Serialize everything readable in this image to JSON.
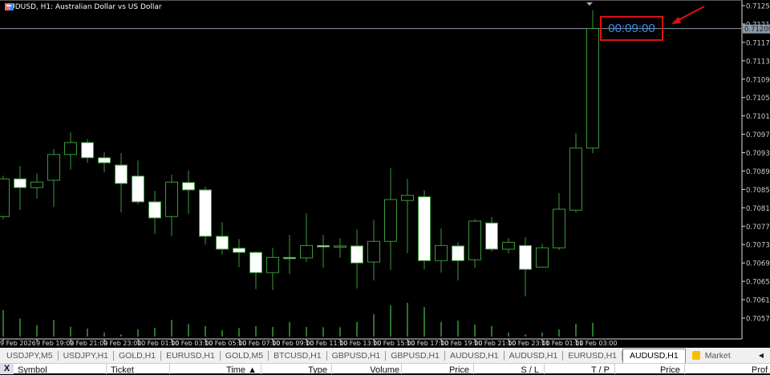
{
  "window": {
    "title": "AUDUSD, H1:  Australian Dollar vs US Dollar",
    "timer": "00:09:00"
  },
  "colors": {
    "background": "#000000",
    "bull": "#3a9a3a",
    "bear_fill": "#ffffff",
    "timer_text": "#3c8df0",
    "highlight_box": "#e01010",
    "volume": "#3a9a3a"
  },
  "chart_data": {
    "type": "candlestick",
    "symbol": "AUDUSD",
    "timeframe": "H1",
    "ylim": [
      0.7055,
      0.7127
    ],
    "price_ticks": [
      "0.71250",
      "0.71210",
      "0.71170",
      "0.71130",
      "0.71090",
      "0.71050",
      "0.71010",
      "0.70970",
      "0.70930",
      "0.70890",
      "0.70850",
      "0.70810",
      "0.70770",
      "0.70730",
      "0.70690",
      "0.70650",
      "0.70610",
      "0.70570"
    ],
    "current_price": "0.71200",
    "time_labels": [
      "9 Feb 2026",
      "9 Feb 19:00",
      "9 Feb 21:00",
      "9 Feb 23:00",
      "10 Feb 01:00",
      "10 Feb 03:00",
      "10 Feb 05:00",
      "10 Feb 07:00",
      "10 Feb 09:00",
      "10 Feb 11:00",
      "10 Feb 13:00",
      "10 Feb 15:00",
      "10 Feb 17:00",
      "10 Feb 19:00",
      "10 Feb 21:00",
      "10 Feb 23:00",
      "11 Feb 01:00",
      "11 Feb 03:00"
    ],
    "ohlc": [
      [
        0.70791,
        0.7088,
        0.70785,
        0.70873
      ],
      [
        0.70873,
        0.70901,
        0.70805,
        0.70854
      ],
      [
        0.70854,
        0.70885,
        0.7083,
        0.70866
      ],
      [
        0.7087,
        0.70938,
        0.70812,
        0.70926
      ],
      [
        0.70926,
        0.70974,
        0.70893,
        0.70952
      ],
      [
        0.70952,
        0.7096,
        0.70908,
        0.70919
      ],
      [
        0.70919,
        0.70931,
        0.70887,
        0.70908
      ],
      [
        0.70903,
        0.70929,
        0.708,
        0.70863
      ],
      [
        0.70879,
        0.70913,
        0.70818,
        0.70823
      ],
      [
        0.70823,
        0.70847,
        0.70753,
        0.70788
      ],
      [
        0.70791,
        0.70882,
        0.70748,
        0.70866
      ],
      [
        0.70865,
        0.70891,
        0.70797,
        0.70849
      ],
      [
        0.70849,
        0.70856,
        0.7073,
        0.70748
      ],
      [
        0.70748,
        0.70779,
        0.70708,
        0.7072
      ],
      [
        0.70722,
        0.70742,
        0.70681,
        0.70713
      ],
      [
        0.70713,
        0.70715,
        0.70633,
        0.70669
      ],
      [
        0.70669,
        0.70723,
        0.70631,
        0.70702
      ],
      [
        0.70702,
        0.70751,
        0.70666,
        0.707
      ],
      [
        0.70701,
        0.70798,
        0.70692,
        0.70728
      ],
      [
        0.70728,
        0.70751,
        0.7068,
        0.70725
      ],
      [
        0.70727,
        0.70744,
        0.70701,
        0.70727
      ],
      [
        0.70727,
        0.70763,
        0.70634,
        0.7069
      ],
      [
        0.70692,
        0.70784,
        0.70652,
        0.70737
      ],
      [
        0.70737,
        0.70896,
        0.70675,
        0.70828
      ],
      [
        0.70826,
        0.70873,
        0.70711,
        0.70837
      ],
      [
        0.70834,
        0.70848,
        0.70676,
        0.70695
      ],
      [
        0.70695,
        0.70765,
        0.70669,
        0.70728
      ],
      [
        0.70727,
        0.70735,
        0.70652,
        0.70695
      ],
      [
        0.70697,
        0.70786,
        0.7068,
        0.70781
      ],
      [
        0.70777,
        0.7079,
        0.70715,
        0.7072
      ],
      [
        0.7072,
        0.70744,
        0.70711,
        0.70735
      ],
      [
        0.70728,
        0.70746,
        0.70617,
        0.70676
      ],
      [
        0.70681,
        0.70732,
        0.70681,
        0.70723
      ],
      [
        0.70723,
        0.70842,
        0.70718,
        0.70807
      ],
      [
        0.70805,
        0.70973,
        0.708,
        0.7094
      ],
      [
        0.7094,
        0.7124,
        0.70929,
        0.712
      ]
    ],
    "volumes": [
      100,
      68,
      43,
      63,
      37,
      30,
      15,
      8,
      27,
      33,
      63,
      48,
      40,
      24,
      32,
      40,
      36,
      55,
      36,
      35,
      35,
      55,
      84,
      117,
      127,
      111,
      55,
      60,
      45,
      40,
      15,
      8,
      15,
      27,
      48,
      52
    ]
  },
  "tabs": [
    {
      "label": "USDJPY,M5"
    },
    {
      "label": "USDJPY,H1"
    },
    {
      "label": "GOLD,H1"
    },
    {
      "label": "EURUSD,H1"
    },
    {
      "label": "GOLD,M5"
    },
    {
      "label": "BTCUSD,H1"
    },
    {
      "label": "GBPUSD,H1"
    },
    {
      "label": "GBPUSD,H1"
    },
    {
      "label": "AUDUSD,H1"
    },
    {
      "label": "AUDUSD,H1"
    },
    {
      "label": "EURUSD,H1"
    },
    {
      "label": "AUDUSD,H1"
    }
  ],
  "market_tab": "Market",
  "table": {
    "close": "X",
    "headers": [
      "Symbol",
      "Ticket",
      "Time ▲",
      "Type",
      "Volume",
      "Price",
      "S / L",
      "T / P",
      "Price",
      "Prof"
    ]
  }
}
